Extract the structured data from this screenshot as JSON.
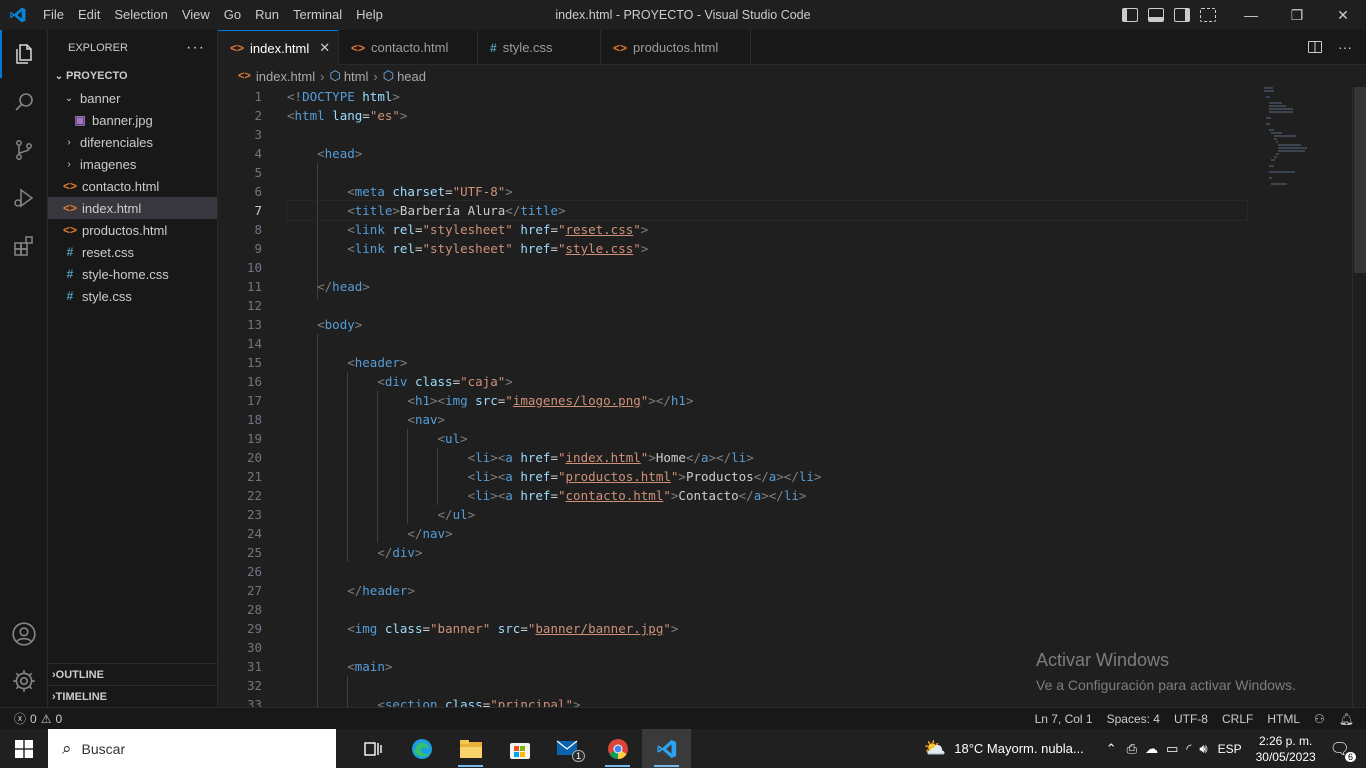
{
  "window": {
    "title": "index.html - PROYECTO - Visual Studio Code",
    "menu": [
      "File",
      "Edit",
      "Selection",
      "View",
      "Go",
      "Run",
      "Terminal",
      "Help"
    ],
    "controls": {
      "minimize": "—",
      "maximize": "❐",
      "close": "✕"
    }
  },
  "activity_bar": {
    "items": [
      "explorer-icon",
      "search-icon",
      "source-control-icon",
      "run-debug-icon",
      "extensions-icon"
    ],
    "bottom": [
      "account-icon",
      "settings-icon"
    ]
  },
  "sidebar": {
    "title": "EXPLORER",
    "more": "···",
    "root": "PROYECTO",
    "items": [
      {
        "label": "banner",
        "type": "folder",
        "open": true,
        "depth": 1
      },
      {
        "label": "banner.jpg",
        "type": "image",
        "depth": 2
      },
      {
        "label": "diferenciales",
        "type": "folder",
        "open": false,
        "depth": 1
      },
      {
        "label": "imagenes",
        "type": "folder",
        "open": false,
        "depth": 1
      },
      {
        "label": "contacto.html",
        "type": "html",
        "depth": 1
      },
      {
        "label": "index.html",
        "type": "html",
        "depth": 1,
        "selected": true
      },
      {
        "label": "productos.html",
        "type": "html",
        "depth": 1
      },
      {
        "label": "reset.css",
        "type": "css",
        "depth": 1
      },
      {
        "label": "style-home.css",
        "type": "css",
        "depth": 1
      },
      {
        "label": "style.css",
        "type": "css",
        "depth": 1
      }
    ],
    "outline": "OUTLINE",
    "timeline": "TIMELINE"
  },
  "tabs": [
    {
      "label": "index.html",
      "type": "html",
      "active": true
    },
    {
      "label": "contacto.html",
      "type": "html"
    },
    {
      "label": "style.css",
      "type": "css"
    },
    {
      "label": "productos.html",
      "type": "html"
    }
  ],
  "breadcrumb": [
    "index.html",
    "html",
    "head"
  ],
  "editor": {
    "current_line": 7,
    "lines": [
      [
        [
          "p",
          "<!"
        ],
        [
          "t",
          "DOCTYPE"
        ],
        [
          "a",
          " html"
        ],
        [
          "p",
          ">"
        ]
      ],
      [
        [
          "p",
          "<"
        ],
        [
          "t",
          "html"
        ],
        [
          "a",
          " lang"
        ],
        [
          "x",
          "="
        ],
        [
          "s",
          "\"es\""
        ],
        [
          "p",
          ">"
        ]
      ],
      [],
      [
        [
          "x",
          "    "
        ],
        [
          "p",
          "<"
        ],
        [
          "t",
          "head"
        ],
        [
          "p",
          ">"
        ]
      ],
      [],
      [
        [
          "x",
          "        "
        ],
        [
          "p",
          "<"
        ],
        [
          "t",
          "meta"
        ],
        [
          "a",
          " charset"
        ],
        [
          "x",
          "="
        ],
        [
          "s",
          "\"UTF-8\""
        ],
        [
          "p",
          ">"
        ]
      ],
      [
        [
          "x",
          "        "
        ],
        [
          "p",
          "<"
        ],
        [
          "t",
          "title"
        ],
        [
          "p",
          ">"
        ],
        [
          "x",
          "Barbería Alura"
        ],
        [
          "p",
          "</"
        ],
        [
          "t",
          "title"
        ],
        [
          "p",
          ">"
        ]
      ],
      [
        [
          "x",
          "        "
        ],
        [
          "p",
          "<"
        ],
        [
          "t",
          "link"
        ],
        [
          "a",
          " rel"
        ],
        [
          "x",
          "="
        ],
        [
          "s",
          "\"stylesheet\""
        ],
        [
          "a",
          " href"
        ],
        [
          "x",
          "="
        ],
        [
          "s",
          "\""
        ],
        [
          "u",
          "reset.css"
        ],
        [
          "s",
          "\""
        ],
        [
          "p",
          ">"
        ]
      ],
      [
        [
          "x",
          "        "
        ],
        [
          "p",
          "<"
        ],
        [
          "t",
          "link"
        ],
        [
          "a",
          " rel"
        ],
        [
          "x",
          "="
        ],
        [
          "s",
          "\"stylesheet\""
        ],
        [
          "a",
          " href"
        ],
        [
          "x",
          "="
        ],
        [
          "s",
          "\""
        ],
        [
          "u",
          "style.css"
        ],
        [
          "s",
          "\""
        ],
        [
          "p",
          ">"
        ]
      ],
      [],
      [
        [
          "x",
          "    "
        ],
        [
          "p",
          "</"
        ],
        [
          "t",
          "head"
        ],
        [
          "p",
          ">"
        ]
      ],
      [],
      [
        [
          "x",
          "    "
        ],
        [
          "p",
          "<"
        ],
        [
          "t",
          "body"
        ],
        [
          "p",
          ">"
        ]
      ],
      [],
      [
        [
          "x",
          "        "
        ],
        [
          "p",
          "<"
        ],
        [
          "t",
          "header"
        ],
        [
          "p",
          ">"
        ]
      ],
      [
        [
          "x",
          "            "
        ],
        [
          "p",
          "<"
        ],
        [
          "t",
          "div"
        ],
        [
          "a",
          " class"
        ],
        [
          "x",
          "="
        ],
        [
          "s",
          "\"caja\""
        ],
        [
          "p",
          ">"
        ]
      ],
      [
        [
          "x",
          "                "
        ],
        [
          "p",
          "<"
        ],
        [
          "t",
          "h1"
        ],
        [
          "p",
          "><"
        ],
        [
          "t",
          "img"
        ],
        [
          "a",
          " src"
        ],
        [
          "x",
          "="
        ],
        [
          "s",
          "\""
        ],
        [
          "u",
          "imagenes/logo.png"
        ],
        [
          "s",
          "\""
        ],
        [
          "p",
          "></"
        ],
        [
          "t",
          "h1"
        ],
        [
          "p",
          ">"
        ]
      ],
      [
        [
          "x",
          "                "
        ],
        [
          "p",
          "<"
        ],
        [
          "t",
          "nav"
        ],
        [
          "p",
          ">"
        ]
      ],
      [
        [
          "x",
          "                    "
        ],
        [
          "p",
          "<"
        ],
        [
          "t",
          "ul"
        ],
        [
          "p",
          ">"
        ]
      ],
      [
        [
          "x",
          "                        "
        ],
        [
          "p",
          "<"
        ],
        [
          "t",
          "li"
        ],
        [
          "p",
          "><"
        ],
        [
          "t",
          "a"
        ],
        [
          "a",
          " href"
        ],
        [
          "x",
          "="
        ],
        [
          "s",
          "\""
        ],
        [
          "u",
          "index.html"
        ],
        [
          "s",
          "\""
        ],
        [
          "p",
          ">"
        ],
        [
          "x",
          "Home"
        ],
        [
          "p",
          "</"
        ],
        [
          "t",
          "a"
        ],
        [
          "p",
          "></"
        ],
        [
          "t",
          "li"
        ],
        [
          "p",
          ">"
        ]
      ],
      [
        [
          "x",
          "                        "
        ],
        [
          "p",
          "<"
        ],
        [
          "t",
          "li"
        ],
        [
          "p",
          "><"
        ],
        [
          "t",
          "a"
        ],
        [
          "a",
          " href"
        ],
        [
          "x",
          "="
        ],
        [
          "s",
          "\""
        ],
        [
          "u",
          "productos.html"
        ],
        [
          "s",
          "\""
        ],
        [
          "p",
          ">"
        ],
        [
          "x",
          "Productos"
        ],
        [
          "p",
          "</"
        ],
        [
          "t",
          "a"
        ],
        [
          "p",
          "></"
        ],
        [
          "t",
          "li"
        ],
        [
          "p",
          ">"
        ]
      ],
      [
        [
          "x",
          "                        "
        ],
        [
          "p",
          "<"
        ],
        [
          "t",
          "li"
        ],
        [
          "p",
          "><"
        ],
        [
          "t",
          "a"
        ],
        [
          "a",
          " href"
        ],
        [
          "x",
          "="
        ],
        [
          "s",
          "\""
        ],
        [
          "u",
          "contacto.html"
        ],
        [
          "s",
          "\""
        ],
        [
          "p",
          ">"
        ],
        [
          "x",
          "Contacto"
        ],
        [
          "p",
          "</"
        ],
        [
          "t",
          "a"
        ],
        [
          "p",
          "></"
        ],
        [
          "t",
          "li"
        ],
        [
          "p",
          ">"
        ]
      ],
      [
        [
          "x",
          "                    "
        ],
        [
          "p",
          "</"
        ],
        [
          "t",
          "ul"
        ],
        [
          "p",
          ">"
        ]
      ],
      [
        [
          "x",
          "                "
        ],
        [
          "p",
          "</"
        ],
        [
          "t",
          "nav"
        ],
        [
          "p",
          ">"
        ]
      ],
      [
        [
          "x",
          "            "
        ],
        [
          "p",
          "</"
        ],
        [
          "t",
          "div"
        ],
        [
          "p",
          ">"
        ]
      ],
      [],
      [
        [
          "x",
          "        "
        ],
        [
          "p",
          "</"
        ],
        [
          "t",
          "header"
        ],
        [
          "p",
          ">"
        ]
      ],
      [],
      [
        [
          "x",
          "        "
        ],
        [
          "p",
          "<"
        ],
        [
          "t",
          "img"
        ],
        [
          "a",
          " class"
        ],
        [
          "x",
          "="
        ],
        [
          "s",
          "\"banner\""
        ],
        [
          "a",
          " src"
        ],
        [
          "x",
          "="
        ],
        [
          "s",
          "\""
        ],
        [
          "u",
          "banner/banner.jpg"
        ],
        [
          "s",
          "\""
        ],
        [
          "p",
          ">"
        ]
      ],
      [],
      [
        [
          "x",
          "        "
        ],
        [
          "p",
          "<"
        ],
        [
          "t",
          "main"
        ],
        [
          "p",
          ">"
        ]
      ],
      [],
      [
        [
          "x",
          "            "
        ],
        [
          "p",
          "<"
        ],
        [
          "t",
          "section"
        ],
        [
          "a",
          " class"
        ],
        [
          "x",
          "="
        ],
        [
          "s",
          "\"principal\""
        ],
        [
          "p",
          ">"
        ]
      ]
    ]
  },
  "watermark": {
    "line1": "Activar Windows",
    "line2": "Ve a Configuración para activar Windows."
  },
  "statusbar": {
    "errors": "0",
    "warnings": "0",
    "position": "Ln 7, Col 1",
    "spaces": "Spaces: 4",
    "encoding": "UTF-8",
    "eol": "CRLF",
    "language": "HTML"
  },
  "taskbar": {
    "search_placeholder": "Buscar",
    "apps": [
      "task-view",
      "edge",
      "file-explorer",
      "store",
      "mail",
      "chrome",
      "vscode"
    ],
    "mail_badge": "1",
    "weather": "18°C  Mayorm. nubla...",
    "lang": "ESP",
    "time": "2:26 p. m.",
    "date": "30/05/2023",
    "notifications": "6"
  }
}
